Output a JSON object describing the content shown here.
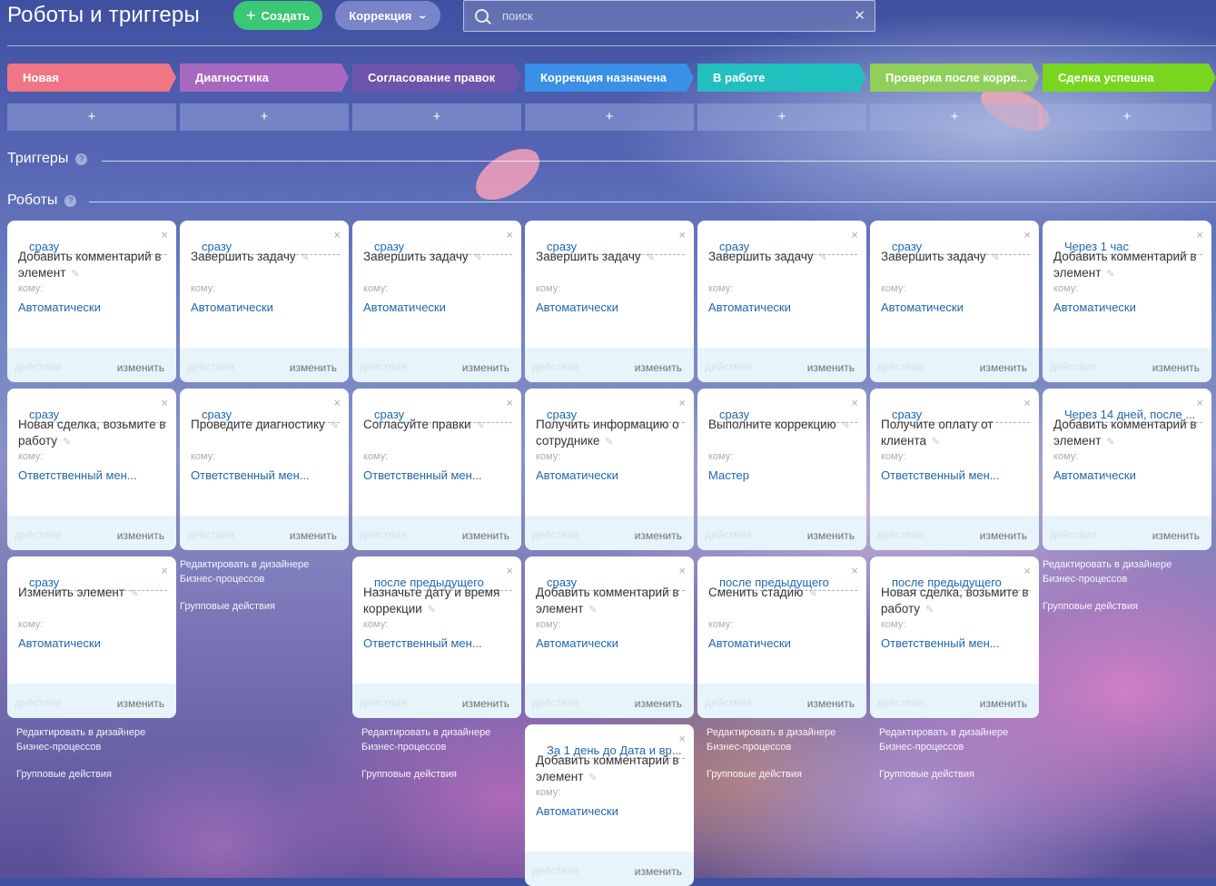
{
  "header": {
    "title": "Роботы и триггеры",
    "create_label": "Создать",
    "filter_label": "Коррекция",
    "search_placeholder": "поиск"
  },
  "stages": [
    {
      "label": "Новая",
      "color": "#f07585"
    },
    {
      "label": "Диагностика",
      "color": "#a868bf"
    },
    {
      "label": "Согласование правок",
      "color": "#6d54ac"
    },
    {
      "label": "Коррекция назначена",
      "color": "#3a8fe6"
    },
    {
      "label": "В работе",
      "color": "#22bfbf"
    },
    {
      "label": "Проверка после корре...",
      "color": "#8fcf5a"
    },
    {
      "label": "Сделка успешна",
      "color": "#79d61e"
    }
  ],
  "add_label": "+",
  "sections": {
    "triggers": "Триггеры",
    "robots": "Роботы",
    "help": "?"
  },
  "common": {
    "to_label": "кому:",
    "actions_label": "действия",
    "edit_label": "изменить",
    "designer_link": "Редактировать в дизайнере Бизнес-процессов",
    "group_actions": "Групповые действия"
  },
  "columns": [
    {
      "robots": [
        {
          "when": "сразу",
          "name": "Добавить комментарий в элемент",
          "to": "Автоматически"
        },
        {
          "when": "сразу",
          "name": "Новая сделка, возьмите в работу",
          "to": "Ответственный мен..."
        },
        {
          "when": "сразу",
          "name": "Изменить элемент",
          "to": "Автоматически"
        }
      ]
    },
    {
      "robots": [
        {
          "when": "сразу",
          "name": "Завершить задачу",
          "to": "Автоматически"
        },
        {
          "when": "сразу",
          "name": "Проведите диагностику",
          "to": "Ответственный мен..."
        }
      ]
    },
    {
      "robots": [
        {
          "when": "сразу",
          "name": "Завершить задачу",
          "to": "Автоматически"
        },
        {
          "when": "сразу",
          "name": "Согласуйте правки",
          "to": "Ответственный мен..."
        },
        {
          "when": "после предыдущего",
          "name": "Назначьте дату и время коррекции",
          "to": "Ответственный мен..."
        }
      ]
    },
    {
      "robots": [
        {
          "when": "сразу",
          "name": "Завершить задачу",
          "to": "Автоматически"
        },
        {
          "when": "сразу",
          "name": "Получить информацию о сотруднике",
          "to": "Автоматически"
        },
        {
          "when": "сразу",
          "name": "Добавить комментарий в элемент",
          "to": "Автоматически"
        },
        {
          "when": "За 1 день до Дата и вр...",
          "name": "Добавить комментарий в элемент",
          "to": "Автоматически"
        }
      ]
    },
    {
      "robots": [
        {
          "when": "сразу",
          "name": "Завершить задачу",
          "to": "Автоматически"
        },
        {
          "when": "сразу",
          "name": "Выполните коррекцию",
          "to": "Мастер"
        },
        {
          "when": "после предыдущего",
          "name": "Сменить стадию",
          "to": "Автоматически"
        }
      ]
    },
    {
      "robots": [
        {
          "when": "сразу",
          "name": "Завершить задачу",
          "to": "Автоматически"
        },
        {
          "when": "сразу",
          "name": "Получите оплату от клиента",
          "to": "Ответственный мен..."
        },
        {
          "when": "после предыдущего",
          "name": "Новая сделка, возьмите в работу",
          "to": "Ответственный мен..."
        }
      ]
    },
    {
      "robots": [
        {
          "when": "Через 1 час",
          "name": "Добавить комментарий в элемент",
          "to": "Автоматически"
        },
        {
          "when": "Через 14 дней, после ...",
          "name": "Добавить комментарий в элемент",
          "to": "Автоматически"
        }
      ]
    }
  ]
}
